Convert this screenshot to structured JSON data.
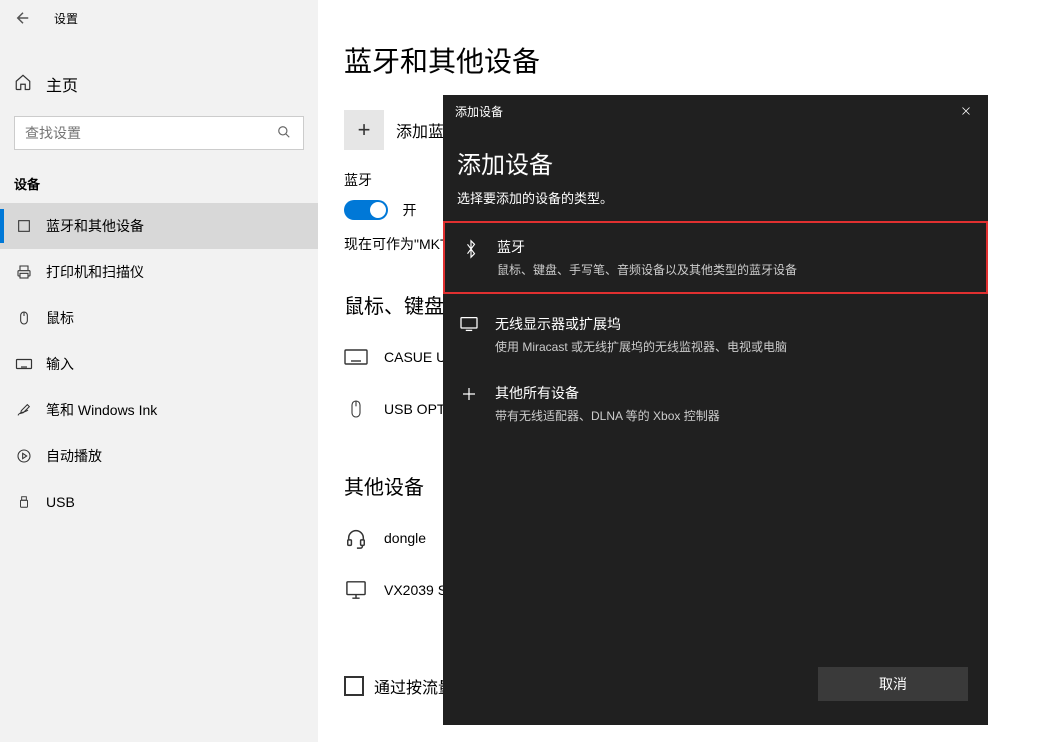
{
  "header": {
    "settings": "设置"
  },
  "sidebar": {
    "home": "主页",
    "searchPlaceholder": "查找设置",
    "sectionLabel": "设备",
    "items": [
      {
        "label": "蓝牙和其他设备"
      },
      {
        "label": "打印机和扫描仪"
      },
      {
        "label": "鼠标"
      },
      {
        "label": "输入"
      },
      {
        "label": "笔和 Windows Ink"
      },
      {
        "label": "自动播放"
      },
      {
        "label": "USB"
      }
    ]
  },
  "main": {
    "title": "蓝牙和其他设备",
    "addDevice": "添加蓝牙",
    "btLabel": "蓝牙",
    "toggleLabel": "开",
    "discoverText": "现在可作为\"MKT",
    "subsection1": "鼠标、键盘",
    "dev1": "CASUE U",
    "dev2": "USB OPT",
    "subsection2": "其他设备",
    "dev3": "dongle",
    "dev4": "VX2039 S",
    "checkboxLabel": "通过按流量"
  },
  "dialog": {
    "headerTitle": "添加设备",
    "title": "添加设备",
    "subtitle": "选择要添加的设备的类型。",
    "options": [
      {
        "title": "蓝牙",
        "desc": "鼠标、键盘、手写笔、音频设备以及其他类型的蓝牙设备"
      },
      {
        "title": "无线显示器或扩展坞",
        "desc": "使用 Miracast 或无线扩展坞的无线监视器、电视或电脑"
      },
      {
        "title": "其他所有设备",
        "desc": "带有无线适配器、DLNA 等的 Xbox 控制器"
      }
    ],
    "cancel": "取消"
  }
}
